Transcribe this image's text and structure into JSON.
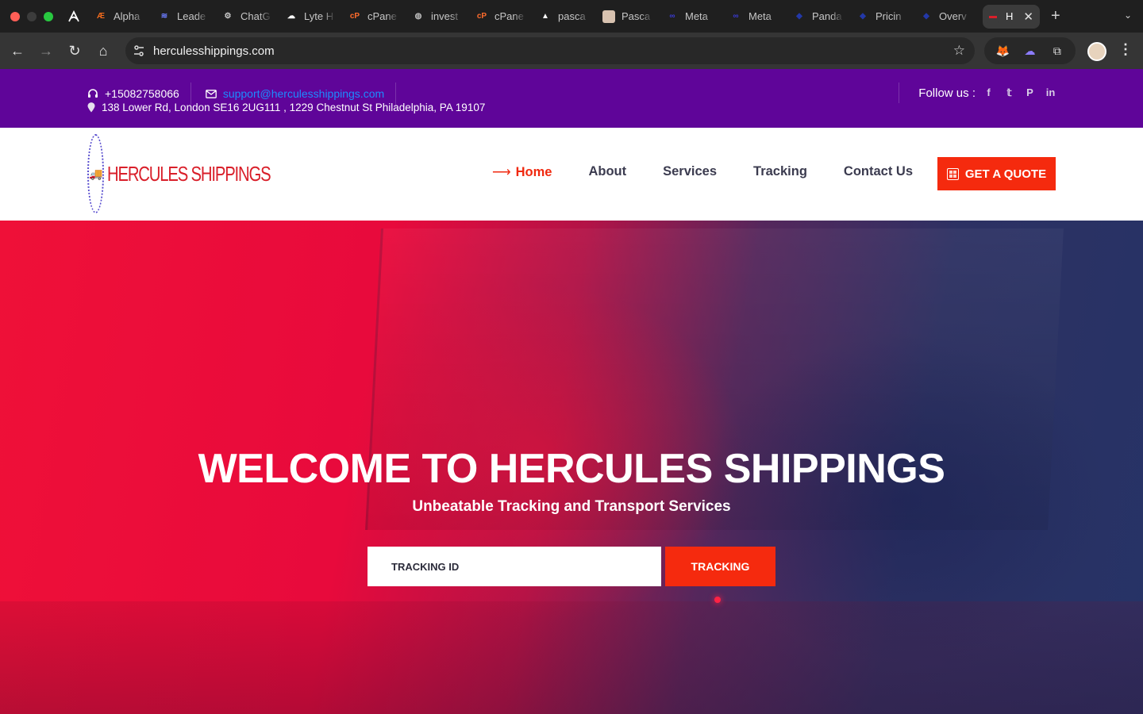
{
  "browser": {
    "tabs": [
      {
        "label": "",
        "icon": "arc-logo-icon",
        "color": "#ffffff"
      },
      {
        "label": "Alpha",
        "icon": "alpha-icon",
        "color": "#f26b1d",
        "glyph": "Æ"
      },
      {
        "label": "Leade",
        "icon": "layers-icon",
        "color": "#6b7cff",
        "glyph": "≋"
      },
      {
        "label": "ChatG",
        "icon": "openai-icon",
        "color": "#cccccc",
        "glyph": "⚙"
      },
      {
        "label": "Lyte H",
        "icon": "cloud-icon",
        "color": "#ffffff",
        "glyph": "☁"
      },
      {
        "label": "cPane",
        "icon": "cpanel-icon",
        "color": "#ff6c2c",
        "glyph": "cP"
      },
      {
        "label": "invest",
        "icon": "globe-icon",
        "color": "#bbbbbb",
        "glyph": "◍"
      },
      {
        "label": "cPane",
        "icon": "cpanel-icon",
        "color": "#ff6c2c",
        "glyph": "cP"
      },
      {
        "label": "pasca",
        "icon": "triangle-icon",
        "color": "#ffffff",
        "glyph": "▲"
      },
      {
        "label": "Pasca",
        "icon": "profile-photo-icon",
        "color": "#d8c2b0",
        "glyph": ""
      },
      {
        "label": "Meta",
        "icon": "meta-icon",
        "color": "#3b3bd6",
        "glyph": "∞"
      },
      {
        "label": "Meta",
        "icon": "meta-icon",
        "color": "#3b3bd6",
        "glyph": "∞"
      },
      {
        "label": "Panda",
        "icon": "panda-shield-icon",
        "color": "#2338a8",
        "glyph": "◆"
      },
      {
        "label": "Pricin",
        "icon": "panda-shield-icon",
        "color": "#2338a8",
        "glyph": "◆"
      },
      {
        "label": "Overv",
        "icon": "panda-shield-icon",
        "color": "#2338a8",
        "glyph": "◆"
      }
    ],
    "active_tab": {
      "label": "H",
      "icon": "hercules-favicon-icon",
      "color": "#d91f2a"
    },
    "new_tab": "+",
    "url": "herculesshippings.com"
  },
  "topbar": {
    "phone": "+15082758066",
    "email": "support@herculesshippings.com",
    "address": "138 Lower Rd, London SE16 2UG111 , 1229 Chestnut St Philadelphia, PA 19107",
    "follow_label": "Follow us :",
    "social": [
      {
        "name": "facebook-icon",
        "glyph": "f"
      },
      {
        "name": "twitter-icon",
        "glyph": "𝕥"
      },
      {
        "name": "pinterest-icon",
        "glyph": "P"
      },
      {
        "name": "linkedin-icon",
        "glyph": "in"
      }
    ]
  },
  "header": {
    "logo_text": "HERCULES SHIPPINGS",
    "nav": [
      "Home",
      "About",
      "Services",
      "Tracking",
      "Contact Us"
    ],
    "quote_button": "GET A QUOTE"
  },
  "hero": {
    "title": "WELCOME TO HERCULES SHIPPINGS",
    "subtitle": "Unbeatable Tracking and Transport Services",
    "tracking_placeholder": "TRACKING ID",
    "tracking_button": "TRACKING"
  },
  "colors": {
    "topbar_bg": "#5f0599",
    "accent": "#f52a0e",
    "email_link": "#1c8cff"
  }
}
